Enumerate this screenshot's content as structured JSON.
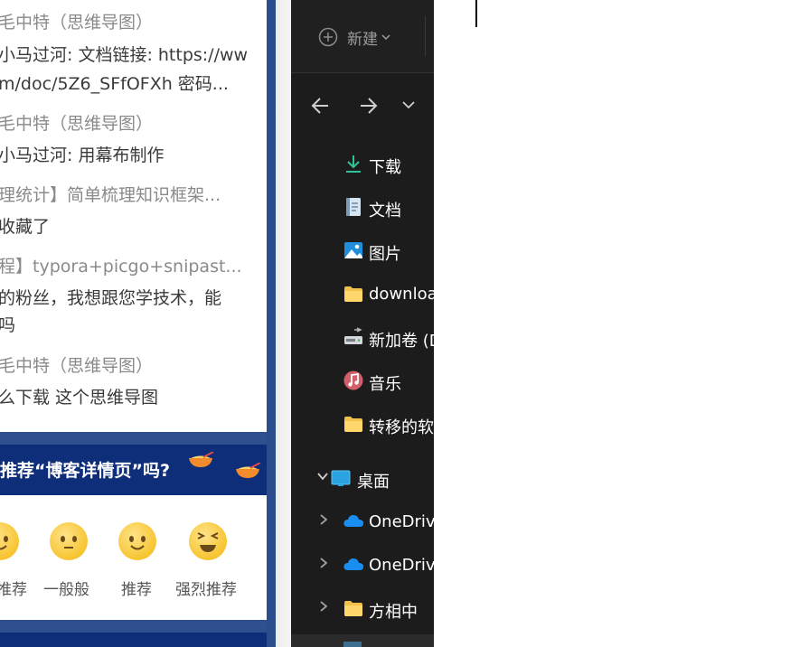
{
  "blog": {
    "comments": [
      {
        "kind": "meta",
        "text": "毛中特（思维导图）"
      },
      {
        "kind": "text",
        "text": "小马过河: 文档链接: https://ww"
      },
      {
        "kind": "text",
        "text": "m/doc/5Z6_SFfOFXh 密码..."
      },
      {
        "kind": "meta",
        "text": "毛中特（思维导图）"
      },
      {
        "kind": "text",
        "text": "小马过河: 用幕布制作"
      },
      {
        "kind": "meta",
        "text": "理统计】简单梳理知识框架..."
      },
      {
        "kind": "text",
        "text": "收藏了"
      },
      {
        "kind": "meta",
        "text": "程】typora+picgo+snipast..."
      },
      {
        "kind": "text",
        "text": "的粉丝，我想跟您学技术，能"
      },
      {
        "kind": "text",
        "text": "吗"
      },
      {
        "kind": "meta",
        "text": "毛中特（思维导图）"
      },
      {
        "kind": "text",
        "text": "么下载 这个思维导图"
      }
    ],
    "recommend_question": "推荐“博客详情页”吗?",
    "ratings": [
      {
        "label": "推荐",
        "face": "wink-icon"
      },
      {
        "label": "一般般",
        "face": "neutral-face-icon"
      },
      {
        "label": "推荐",
        "face": "smile-face-icon"
      },
      {
        "label": "强烈推荐",
        "face": "grin-face-icon"
      }
    ],
    "colors": {
      "banner": "#0f2e7a",
      "frame": "#2f4f8f"
    }
  },
  "explorer": {
    "new_label": "新建",
    "sidebar": [
      {
        "label": "下载",
        "icon": "download-icon"
      },
      {
        "label": "文档",
        "icon": "document-icon"
      },
      {
        "label": "图片",
        "icon": "pictures-icon"
      },
      {
        "label": "downloads",
        "icon": "folder-icon"
      },
      {
        "label": "新加卷 (D:)",
        "icon": "drive-icon"
      },
      {
        "label": "音乐",
        "icon": "music-icon"
      },
      {
        "label": "转移的软件",
        "icon": "folder-icon"
      }
    ],
    "tree": [
      {
        "label": "桌面",
        "icon": "desktop-icon",
        "expanded": true
      },
      {
        "label": "OneDrive",
        "icon": "onedrive-icon",
        "expanded": false
      },
      {
        "label": "OneDrive",
        "icon": "onedrive-icon",
        "expanded": false
      },
      {
        "label": "方相中",
        "icon": "folder-icon",
        "expanded": false
      }
    ],
    "colors": {
      "background": "#1c1c1c",
      "text": "#ffffff",
      "muted": "#9d9d9d"
    }
  }
}
